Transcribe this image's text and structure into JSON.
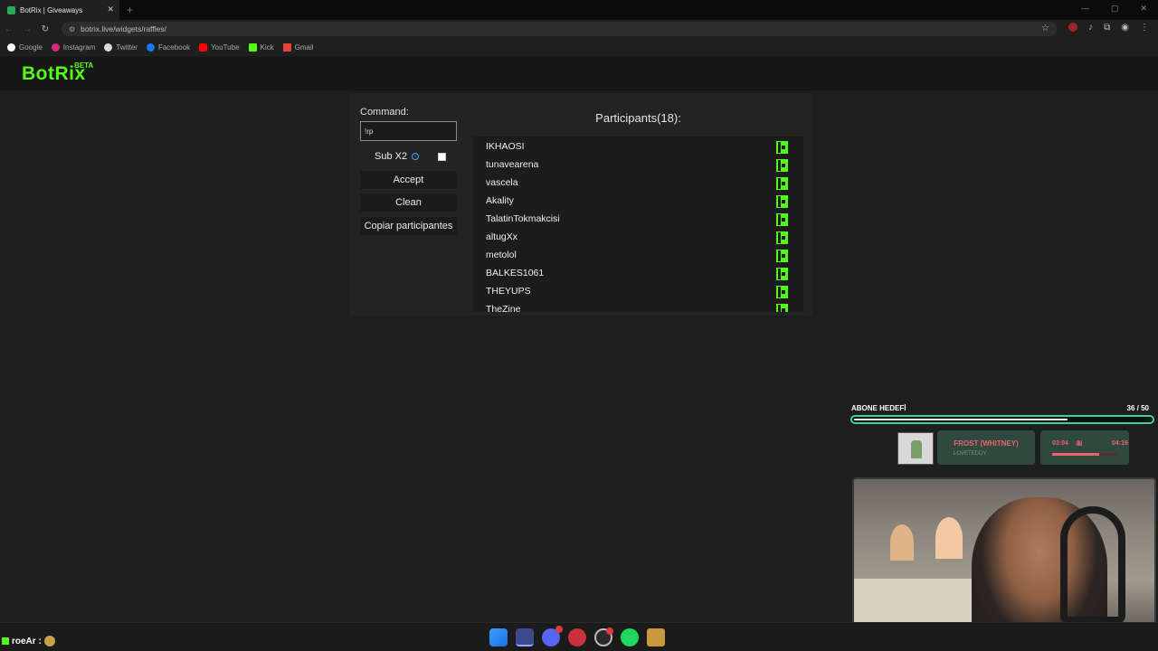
{
  "browser": {
    "tab_title": "BotRix | Giveaways",
    "tab_close": "✕",
    "new_tab": "+",
    "url": "botrix.live/widgets/raffles/",
    "bookmarks": [
      "Google",
      "Instagram",
      "Twitter",
      "Facebook",
      "YouTube",
      "Kick",
      "Gmail"
    ],
    "bookmark_colors": [
      "#ffffff",
      "#d6287c",
      "#dcdcdc",
      "#1877f2",
      "#ff0000",
      "#53fc18",
      "#ea4335"
    ]
  },
  "brand": {
    "logo": "BotRix",
    "beta": "BETA",
    "accent": "#53fc18"
  },
  "raffle": {
    "command_label": "Command:",
    "command_value": "!rp",
    "sub_label": "Sub X2",
    "sub_checked": false,
    "accept_label": "Accept",
    "clean_label": "Clean",
    "copy_label": "Copiar participantes",
    "participants_title": "Participants(18):",
    "participants": [
      "IKHAOSI",
      "tunavearena",
      "vascela",
      "Akality",
      "TalatinTokmakcisi",
      "altugXx",
      "metolol",
      "BALKES1061",
      "THEYUPS",
      "TheZine"
    ]
  },
  "overlay": {
    "goal_label": "ABONE HEDEFİ",
    "goal_count": "36  /  50",
    "goal_fraction": 0.72,
    "song": "FROST (WHITNEY)",
    "artist": "LOVETEDDY",
    "time_current": "03:04",
    "time_total": "04:16",
    "song_progress": 0.72,
    "chat_user": "roeAr :"
  },
  "icons": {
    "kick_badge": "kick-logo-icon",
    "info": "info-circle-icon",
    "taskbar": [
      "windows-start-icon",
      "app-icon",
      "discord-icon",
      "red-app-icon",
      "obs-icon",
      "spotify-icon",
      "folder-app-icon"
    ]
  }
}
